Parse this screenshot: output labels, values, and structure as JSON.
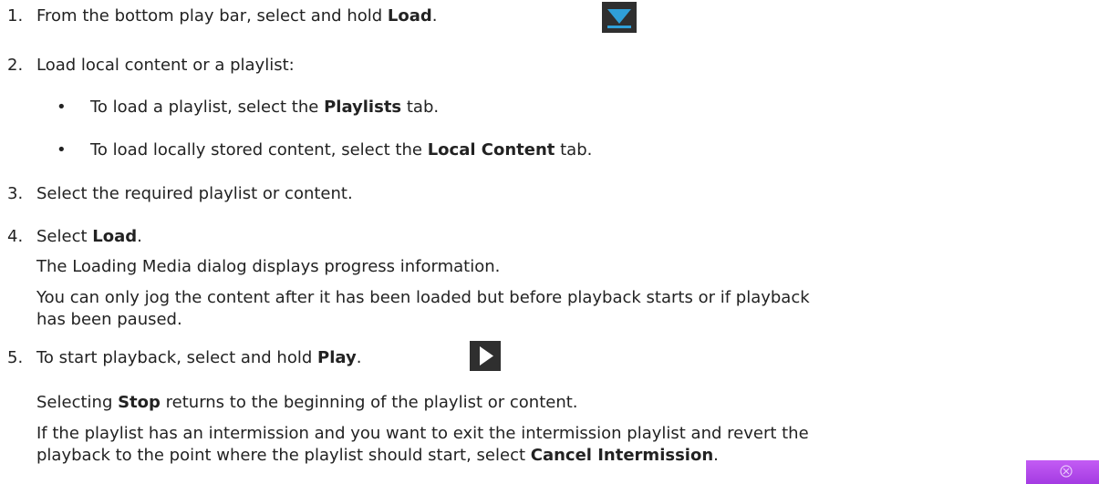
{
  "steps": [
    {
      "number": "1.",
      "text_before": "From the bottom play bar, select and hold ",
      "bold": "Load",
      "text_after": "."
    },
    {
      "number": "2.",
      "text": "Load local content or a playlist:",
      "bullets": [
        {
          "symbol": "•",
          "text_before": "To load a playlist, select the ",
          "bold": "Playlists",
          "text_after": " tab."
        },
        {
          "symbol": "•",
          "text_before": "To load locally stored content, select the ",
          "bold": "Local Content",
          "text_after": " tab."
        }
      ]
    },
    {
      "number": "3.",
      "text": "Select the required playlist or content."
    },
    {
      "number": "4.",
      "text_before": "Select ",
      "bold": "Load",
      "text_after": ".",
      "paragraphs": [
        "The Loading Media dialog displays progress information.",
        "You can only jog the content after it has been loaded but before playback starts or if playback",
        "has been paused."
      ]
    },
    {
      "number": "5.",
      "text_before": "To start playback, select and hold ",
      "bold": "Play",
      "text_after": ".",
      "stop_note": {
        "before": "Selecting ",
        "bold": "Stop",
        "after": " returns to the beginning of the playlist or content."
      },
      "intermission_note": {
        "line1": "If the playlist has an intermission and you want to exit the intermission playlist and revert the",
        "line2_before": "playback to the point where the playlist should start, select ",
        "line2_bold": "Cancel Intermission",
        "line2_after": "."
      }
    }
  ],
  "icons": {
    "load": "download-arrow-icon",
    "play": "play-triangle-icon",
    "cancel_intermission": "cancel-intermission-icon"
  },
  "colors": {
    "text": "#222222",
    "icon_background": "#2f2f2f",
    "load_arrow": "#2f9fd8",
    "intermission_purple": "#b04ce9"
  }
}
